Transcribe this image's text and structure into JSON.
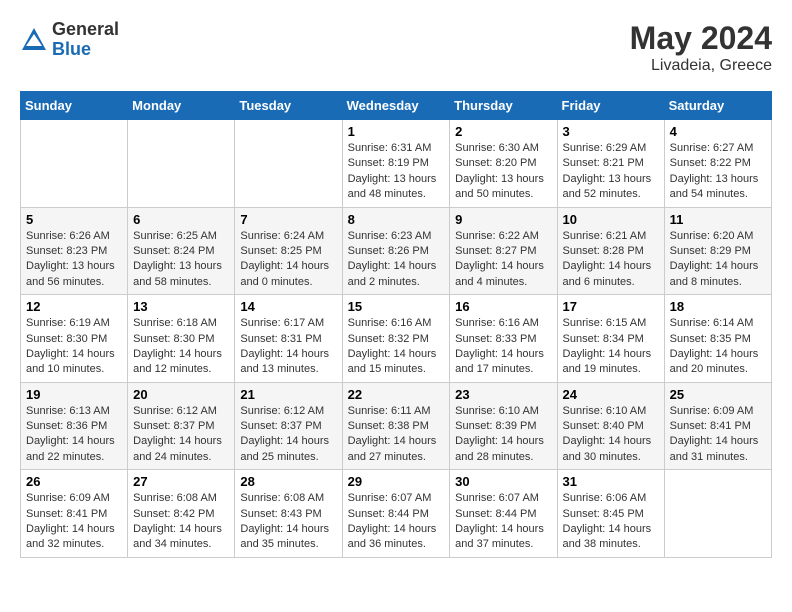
{
  "header": {
    "logo_general": "General",
    "logo_blue": "Blue",
    "month_year": "May 2024",
    "location": "Livadeia, Greece"
  },
  "weekdays": [
    "Sunday",
    "Monday",
    "Tuesday",
    "Wednesday",
    "Thursday",
    "Friday",
    "Saturday"
  ],
  "weeks": [
    [
      {
        "day": "",
        "info": ""
      },
      {
        "day": "",
        "info": ""
      },
      {
        "day": "",
        "info": ""
      },
      {
        "day": "1",
        "sunrise": "Sunrise: 6:31 AM",
        "sunset": "Sunset: 8:19 PM",
        "daylight": "Daylight: 13 hours and 48 minutes."
      },
      {
        "day": "2",
        "sunrise": "Sunrise: 6:30 AM",
        "sunset": "Sunset: 8:20 PM",
        "daylight": "Daylight: 13 hours and 50 minutes."
      },
      {
        "day": "3",
        "sunrise": "Sunrise: 6:29 AM",
        "sunset": "Sunset: 8:21 PM",
        "daylight": "Daylight: 13 hours and 52 minutes."
      },
      {
        "day": "4",
        "sunrise": "Sunrise: 6:27 AM",
        "sunset": "Sunset: 8:22 PM",
        "daylight": "Daylight: 13 hours and 54 minutes."
      }
    ],
    [
      {
        "day": "5",
        "sunrise": "Sunrise: 6:26 AM",
        "sunset": "Sunset: 8:23 PM",
        "daylight": "Daylight: 13 hours and 56 minutes."
      },
      {
        "day": "6",
        "sunrise": "Sunrise: 6:25 AM",
        "sunset": "Sunset: 8:24 PM",
        "daylight": "Daylight: 13 hours and 58 minutes."
      },
      {
        "day": "7",
        "sunrise": "Sunrise: 6:24 AM",
        "sunset": "Sunset: 8:25 PM",
        "daylight": "Daylight: 14 hours and 0 minutes."
      },
      {
        "day": "8",
        "sunrise": "Sunrise: 6:23 AM",
        "sunset": "Sunset: 8:26 PM",
        "daylight": "Daylight: 14 hours and 2 minutes."
      },
      {
        "day": "9",
        "sunrise": "Sunrise: 6:22 AM",
        "sunset": "Sunset: 8:27 PM",
        "daylight": "Daylight: 14 hours and 4 minutes."
      },
      {
        "day": "10",
        "sunrise": "Sunrise: 6:21 AM",
        "sunset": "Sunset: 8:28 PM",
        "daylight": "Daylight: 14 hours and 6 minutes."
      },
      {
        "day": "11",
        "sunrise": "Sunrise: 6:20 AM",
        "sunset": "Sunset: 8:29 PM",
        "daylight": "Daylight: 14 hours and 8 minutes."
      }
    ],
    [
      {
        "day": "12",
        "sunrise": "Sunrise: 6:19 AM",
        "sunset": "Sunset: 8:30 PM",
        "daylight": "Daylight: 14 hours and 10 minutes."
      },
      {
        "day": "13",
        "sunrise": "Sunrise: 6:18 AM",
        "sunset": "Sunset: 8:30 PM",
        "daylight": "Daylight: 14 hours and 12 minutes."
      },
      {
        "day": "14",
        "sunrise": "Sunrise: 6:17 AM",
        "sunset": "Sunset: 8:31 PM",
        "daylight": "Daylight: 14 hours and 13 minutes."
      },
      {
        "day": "15",
        "sunrise": "Sunrise: 6:16 AM",
        "sunset": "Sunset: 8:32 PM",
        "daylight": "Daylight: 14 hours and 15 minutes."
      },
      {
        "day": "16",
        "sunrise": "Sunrise: 6:16 AM",
        "sunset": "Sunset: 8:33 PM",
        "daylight": "Daylight: 14 hours and 17 minutes."
      },
      {
        "day": "17",
        "sunrise": "Sunrise: 6:15 AM",
        "sunset": "Sunset: 8:34 PM",
        "daylight": "Daylight: 14 hours and 19 minutes."
      },
      {
        "day": "18",
        "sunrise": "Sunrise: 6:14 AM",
        "sunset": "Sunset: 8:35 PM",
        "daylight": "Daylight: 14 hours and 20 minutes."
      }
    ],
    [
      {
        "day": "19",
        "sunrise": "Sunrise: 6:13 AM",
        "sunset": "Sunset: 8:36 PM",
        "daylight": "Daylight: 14 hours and 22 minutes."
      },
      {
        "day": "20",
        "sunrise": "Sunrise: 6:12 AM",
        "sunset": "Sunset: 8:37 PM",
        "daylight": "Daylight: 14 hours and 24 minutes."
      },
      {
        "day": "21",
        "sunrise": "Sunrise: 6:12 AM",
        "sunset": "Sunset: 8:37 PM",
        "daylight": "Daylight: 14 hours and 25 minutes."
      },
      {
        "day": "22",
        "sunrise": "Sunrise: 6:11 AM",
        "sunset": "Sunset: 8:38 PM",
        "daylight": "Daylight: 14 hours and 27 minutes."
      },
      {
        "day": "23",
        "sunrise": "Sunrise: 6:10 AM",
        "sunset": "Sunset: 8:39 PM",
        "daylight": "Daylight: 14 hours and 28 minutes."
      },
      {
        "day": "24",
        "sunrise": "Sunrise: 6:10 AM",
        "sunset": "Sunset: 8:40 PM",
        "daylight": "Daylight: 14 hours and 30 minutes."
      },
      {
        "day": "25",
        "sunrise": "Sunrise: 6:09 AM",
        "sunset": "Sunset: 8:41 PM",
        "daylight": "Daylight: 14 hours and 31 minutes."
      }
    ],
    [
      {
        "day": "26",
        "sunrise": "Sunrise: 6:09 AM",
        "sunset": "Sunset: 8:41 PM",
        "daylight": "Daylight: 14 hours and 32 minutes."
      },
      {
        "day": "27",
        "sunrise": "Sunrise: 6:08 AM",
        "sunset": "Sunset: 8:42 PM",
        "daylight": "Daylight: 14 hours and 34 minutes."
      },
      {
        "day": "28",
        "sunrise": "Sunrise: 6:08 AM",
        "sunset": "Sunset: 8:43 PM",
        "daylight": "Daylight: 14 hours and 35 minutes."
      },
      {
        "day": "29",
        "sunrise": "Sunrise: 6:07 AM",
        "sunset": "Sunset: 8:44 PM",
        "daylight": "Daylight: 14 hours and 36 minutes."
      },
      {
        "day": "30",
        "sunrise": "Sunrise: 6:07 AM",
        "sunset": "Sunset: 8:44 PM",
        "daylight": "Daylight: 14 hours and 37 minutes."
      },
      {
        "day": "31",
        "sunrise": "Sunrise: 6:06 AM",
        "sunset": "Sunset: 8:45 PM",
        "daylight": "Daylight: 14 hours and 38 minutes."
      },
      {
        "day": "",
        "info": ""
      }
    ]
  ]
}
